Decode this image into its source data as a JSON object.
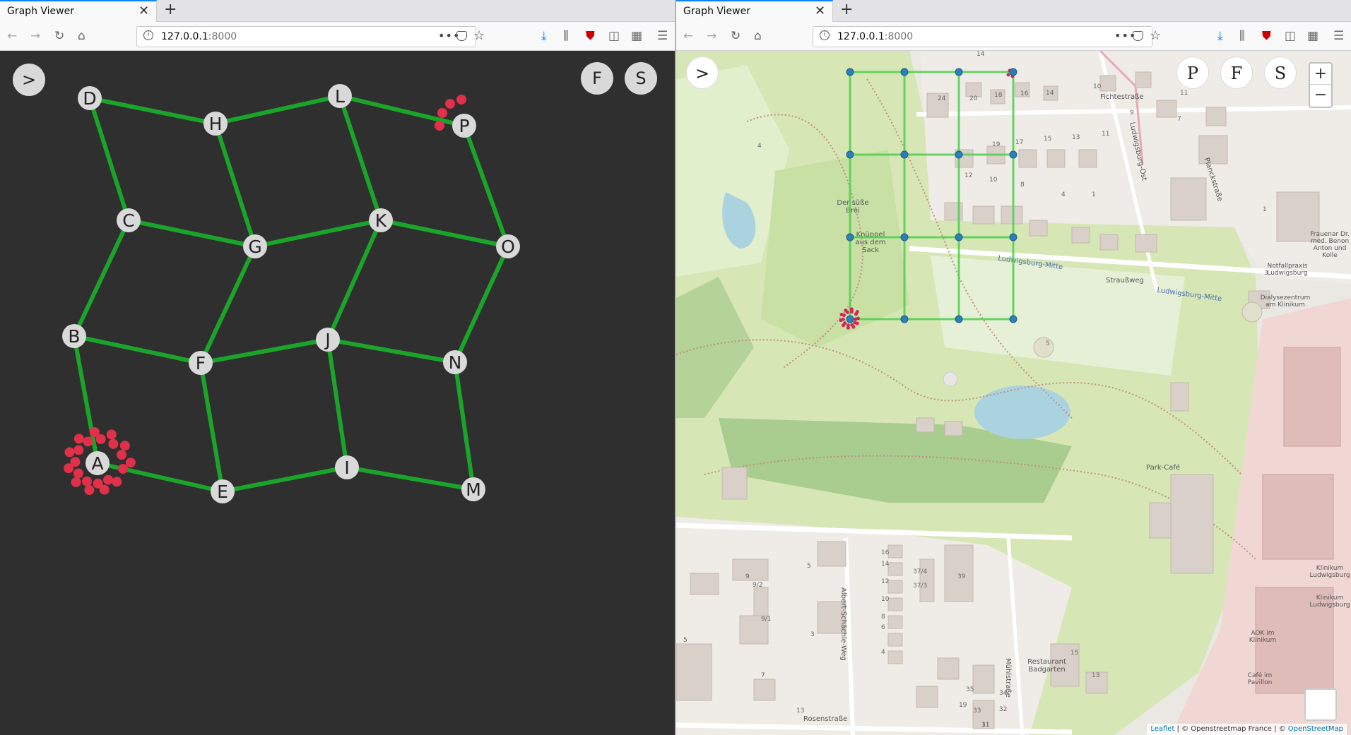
{
  "left": {
    "tab_title": "Graph Viewer",
    "url_host": "127.0.0.1",
    "url_port": ":8000",
    "buttons": {
      "toggle": ">",
      "f": "F",
      "s": "S"
    },
    "graph": {
      "nodes": [
        {
          "id": "A",
          "label": "A"
        },
        {
          "id": "B",
          "label": "B"
        },
        {
          "id": "C",
          "label": "C"
        },
        {
          "id": "D",
          "label": "D"
        },
        {
          "id": "E",
          "label": "E"
        },
        {
          "id": "F",
          "label": "F"
        },
        {
          "id": "G",
          "label": "G"
        },
        {
          "id": "H",
          "label": "H"
        },
        {
          "id": "I",
          "label": "I"
        },
        {
          "id": "J",
          "label": "J"
        },
        {
          "id": "K",
          "label": "K"
        },
        {
          "id": "L",
          "label": "L"
        },
        {
          "id": "M",
          "label": "M"
        },
        {
          "id": "N",
          "label": "N"
        },
        {
          "id": "O",
          "label": "O"
        },
        {
          "id": "P",
          "label": "P"
        }
      ],
      "edges": [
        [
          "D",
          "H"
        ],
        [
          "H",
          "L"
        ],
        [
          "L",
          "P"
        ],
        [
          "C",
          "G"
        ],
        [
          "G",
          "K"
        ],
        [
          "K",
          "O"
        ],
        [
          "B",
          "F"
        ],
        [
          "F",
          "J"
        ],
        [
          "J",
          "N"
        ],
        [
          "A",
          "E"
        ],
        [
          "E",
          "I"
        ],
        [
          "I",
          "M"
        ],
        [
          "D",
          "C"
        ],
        [
          "C",
          "B"
        ],
        [
          "B",
          "A"
        ],
        [
          "H",
          "G"
        ],
        [
          "G",
          "F"
        ],
        [
          "F",
          "E"
        ],
        [
          "L",
          "K"
        ],
        [
          "K",
          "J"
        ],
        [
          "J",
          "I"
        ],
        [
          "P",
          "O"
        ],
        [
          "O",
          "N"
        ],
        [
          "N",
          "M"
        ]
      ],
      "edge_color": "#1aa52a",
      "node_fill": "#d9d9d9",
      "marker_color": "#e0304a",
      "background": "#2f2f2f"
    }
  },
  "right": {
    "tab_title": "Graph Viewer",
    "url_host": "127.0.0.1",
    "url_port": ":8000",
    "buttons": {
      "toggle": ">",
      "p": "P",
      "f": "F",
      "s": "S"
    },
    "zoom": {
      "in": "+",
      "out": "−"
    },
    "attribution": {
      "leaflet": "Leaflet",
      "mid": " | © Openstreetmap France | © ",
      "osm": "OpenStreetMap"
    },
    "grid_color": "#4ccf4c",
    "node_color": "#2e7fb8",
    "map_labels": {
      "fichtestrasse": "Fichtestraße",
      "ludwigsburg_ost": "Ludwigsburg-Ost",
      "planckstrasse": "Planckstraße",
      "straussweg": "Straußweg",
      "ludwigsburg_mitte1": "Ludwigsburg-Mitte",
      "ludwigsburg_mitte2": "Ludwigsburg-Mitte",
      "suesse_brei": "Der süße Brei",
      "knueppel": "Knüppel aus dem Sack",
      "park_cafe": "Park-Café",
      "albert_schaechle": "Albert-Schächle-Weg",
      "muehlstrasse": "Mühlstraße",
      "rosenstrasse": "Rosenstraße",
      "restaurant": "Restaurant Badgarten",
      "frauenarzt": "Frauenar Dr. med. Benon Anton und Kolle",
      "notfallpraxis": "Notfallpraxis Ludwigsburg",
      "dialyse": "Dialysezentrum am Klinikum",
      "klinikum1": "Klinikum Ludwigsburg",
      "klinikum2": "Klinikum Ludwigsburg",
      "aok": "AOK im Klinikum",
      "cafe_pavillon": "Café im Pavillon"
    },
    "house_numbers": [
      "14",
      "10",
      "24",
      "20",
      "18",
      "16",
      "14",
      "9",
      "7",
      "19",
      "17",
      "15",
      "13",
      "11",
      "12",
      "10",
      "8",
      "4",
      "1",
      "11",
      "4",
      "1",
      "3",
      "5",
      "16",
      "14",
      "12",
      "10",
      "8",
      "6",
      "4",
      "37/4",
      "37/3",
      "39",
      "5",
      "9",
      "9/2",
      "9/1",
      "3",
      "7",
      "13",
      "35",
      "33",
      "31",
      "34",
      "32",
      "19",
      "15",
      "13",
      "11",
      "5"
    ]
  }
}
